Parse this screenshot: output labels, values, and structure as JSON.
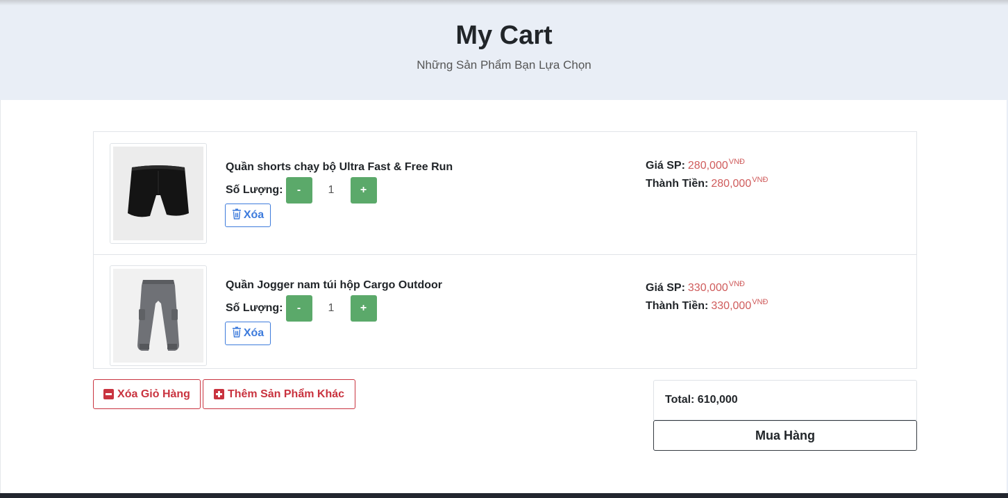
{
  "header": {
    "title": "My Cart",
    "subtitle": "Những Sản Phẩm Bạn Lựa Chọn"
  },
  "cart": {
    "qty_label": "Số Lượng:",
    "minus_label": "-",
    "plus_label": "+",
    "delete_label": "Xóa",
    "price_label": "Giá SP:",
    "subtotal_label": "Thành Tiền:",
    "currency": "VNĐ",
    "items": [
      {
        "name": "Quần shorts chạy bộ Ultra Fast & Free Run",
        "quantity": "1",
        "price": "280,000",
        "subtotal": "280,000",
        "image_icon": "black-shorts-image"
      },
      {
        "name": "Quần Jogger nam túi hộp Cargo Outdoor",
        "quantity": "1",
        "price": "330,000",
        "subtotal": "330,000",
        "image_icon": "gray-jogger-pants-image"
      }
    ]
  },
  "actions": {
    "clear_cart_label": "Xóa Giỏ Hàng",
    "add_more_label": "Thêm Sản Phẩm Khác"
  },
  "summary": {
    "total_text": "Total: 610,000",
    "buy_label": "Mua Hàng"
  },
  "colors": {
    "accent_green": "#5ba96a",
    "accent_blue": "#3d7bdc",
    "accent_red": "#c9333f",
    "price_red": "#cf5b5b",
    "hero_bg": "#e9eef6"
  }
}
